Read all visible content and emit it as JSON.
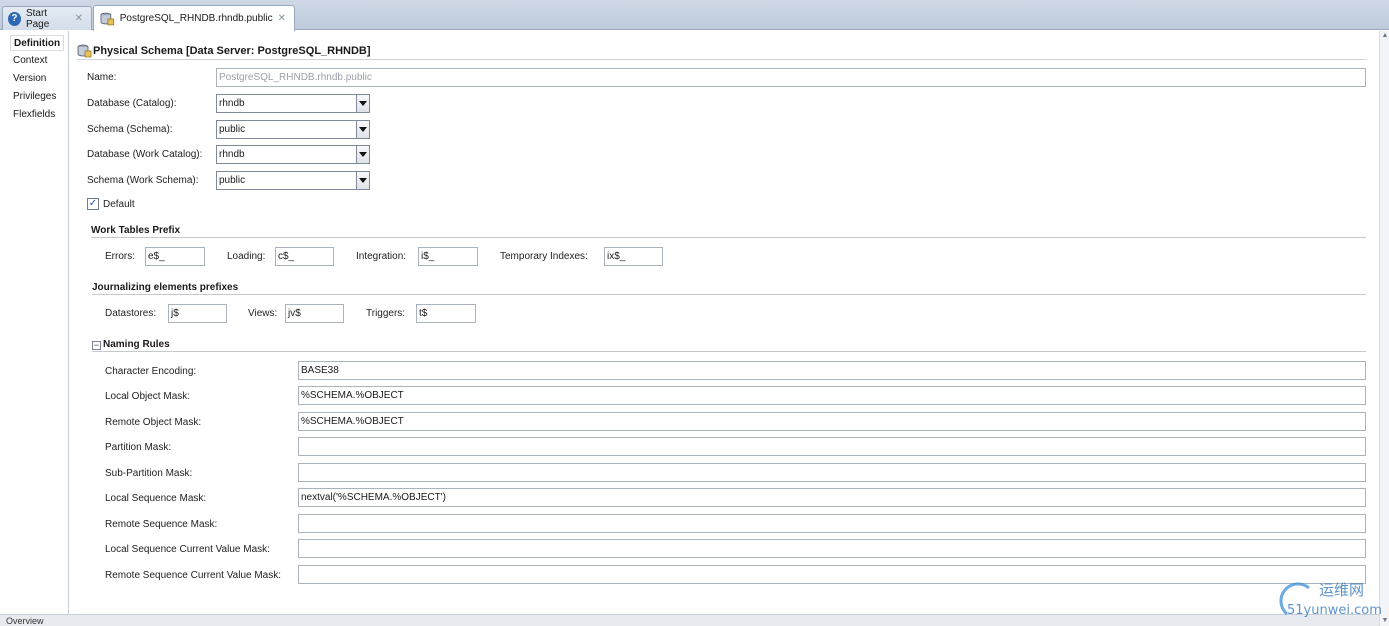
{
  "tabs": [
    {
      "label": "Start Page",
      "active": false
    },
    {
      "label": "PostgreSQL_RHNDB.rhndb.public",
      "active": true
    }
  ],
  "sidebar": {
    "items": [
      {
        "label": "Definition",
        "selected": true
      },
      {
        "label": "Context",
        "selected": false
      },
      {
        "label": "Version",
        "selected": false
      },
      {
        "label": "Privileges",
        "selected": false
      },
      {
        "label": "Flexfields",
        "selected": false
      }
    ]
  },
  "title": "Physical Schema [Data Server: PostgreSQL_RHNDB]",
  "form": {
    "name": {
      "label": "Name:",
      "value": "PostgreSQL_RHNDB.rhndb.public"
    },
    "database_catalog": {
      "label": "Database (Catalog):",
      "value": "rhndb"
    },
    "schema_schema": {
      "label": "Schema (Schema):",
      "value": "public"
    },
    "database_work_catalog": {
      "label": "Database (Work Catalog):",
      "value": "rhndb"
    },
    "schema_work_schema": {
      "label": "Schema (Work Schema):",
      "value": "public"
    },
    "default": {
      "label": "Default",
      "checked": true
    }
  },
  "work_tables_prefix": {
    "title": "Work Tables Prefix",
    "errors": {
      "label": "Errors:",
      "value": "e$_"
    },
    "loading": {
      "label": "Loading:",
      "value": "c$_"
    },
    "integration": {
      "label": "Integration:",
      "value": "i$_"
    },
    "temporary_indexes": {
      "label": "Temporary Indexes:",
      "value": "ix$_"
    }
  },
  "journalizing_prefixes": {
    "title": "Journalizing elements prefixes",
    "datastores": {
      "label": "Datastores:",
      "value": "j$"
    },
    "views": {
      "label": "Views:",
      "value": "jv$"
    },
    "triggers": {
      "label": "Triggers:",
      "value": "t$"
    }
  },
  "naming_rules": {
    "title": "Naming Rules",
    "rows": [
      {
        "label": "Character Encoding:",
        "value": "BASE38"
      },
      {
        "label": "Local Object Mask:",
        "value": "%SCHEMA.%OBJECT"
      },
      {
        "label": "Remote Object Mask:",
        "value": "%SCHEMA.%OBJECT"
      },
      {
        "label": "Partition Mask:",
        "value": ""
      },
      {
        "label": "Sub-Partition Mask:",
        "value": ""
      },
      {
        "label": "Local Sequence Mask:",
        "value": "nextval('%SCHEMA.%OBJECT')"
      },
      {
        "label": "Remote Sequence Mask:",
        "value": ""
      },
      {
        "label": "Local Sequence Current Value Mask:",
        "value": ""
      },
      {
        "label": "Remote Sequence Current Value Mask:",
        "value": ""
      }
    ]
  },
  "bottom_bar": {
    "label": "Overview"
  },
  "watermark": {
    "brand": "运维网",
    "url": "51yunwei.com"
  },
  "icons": {
    "help": "help-icon",
    "schema": "database-schema-icon",
    "close": "close-icon",
    "collapse": "collapse-icon"
  }
}
